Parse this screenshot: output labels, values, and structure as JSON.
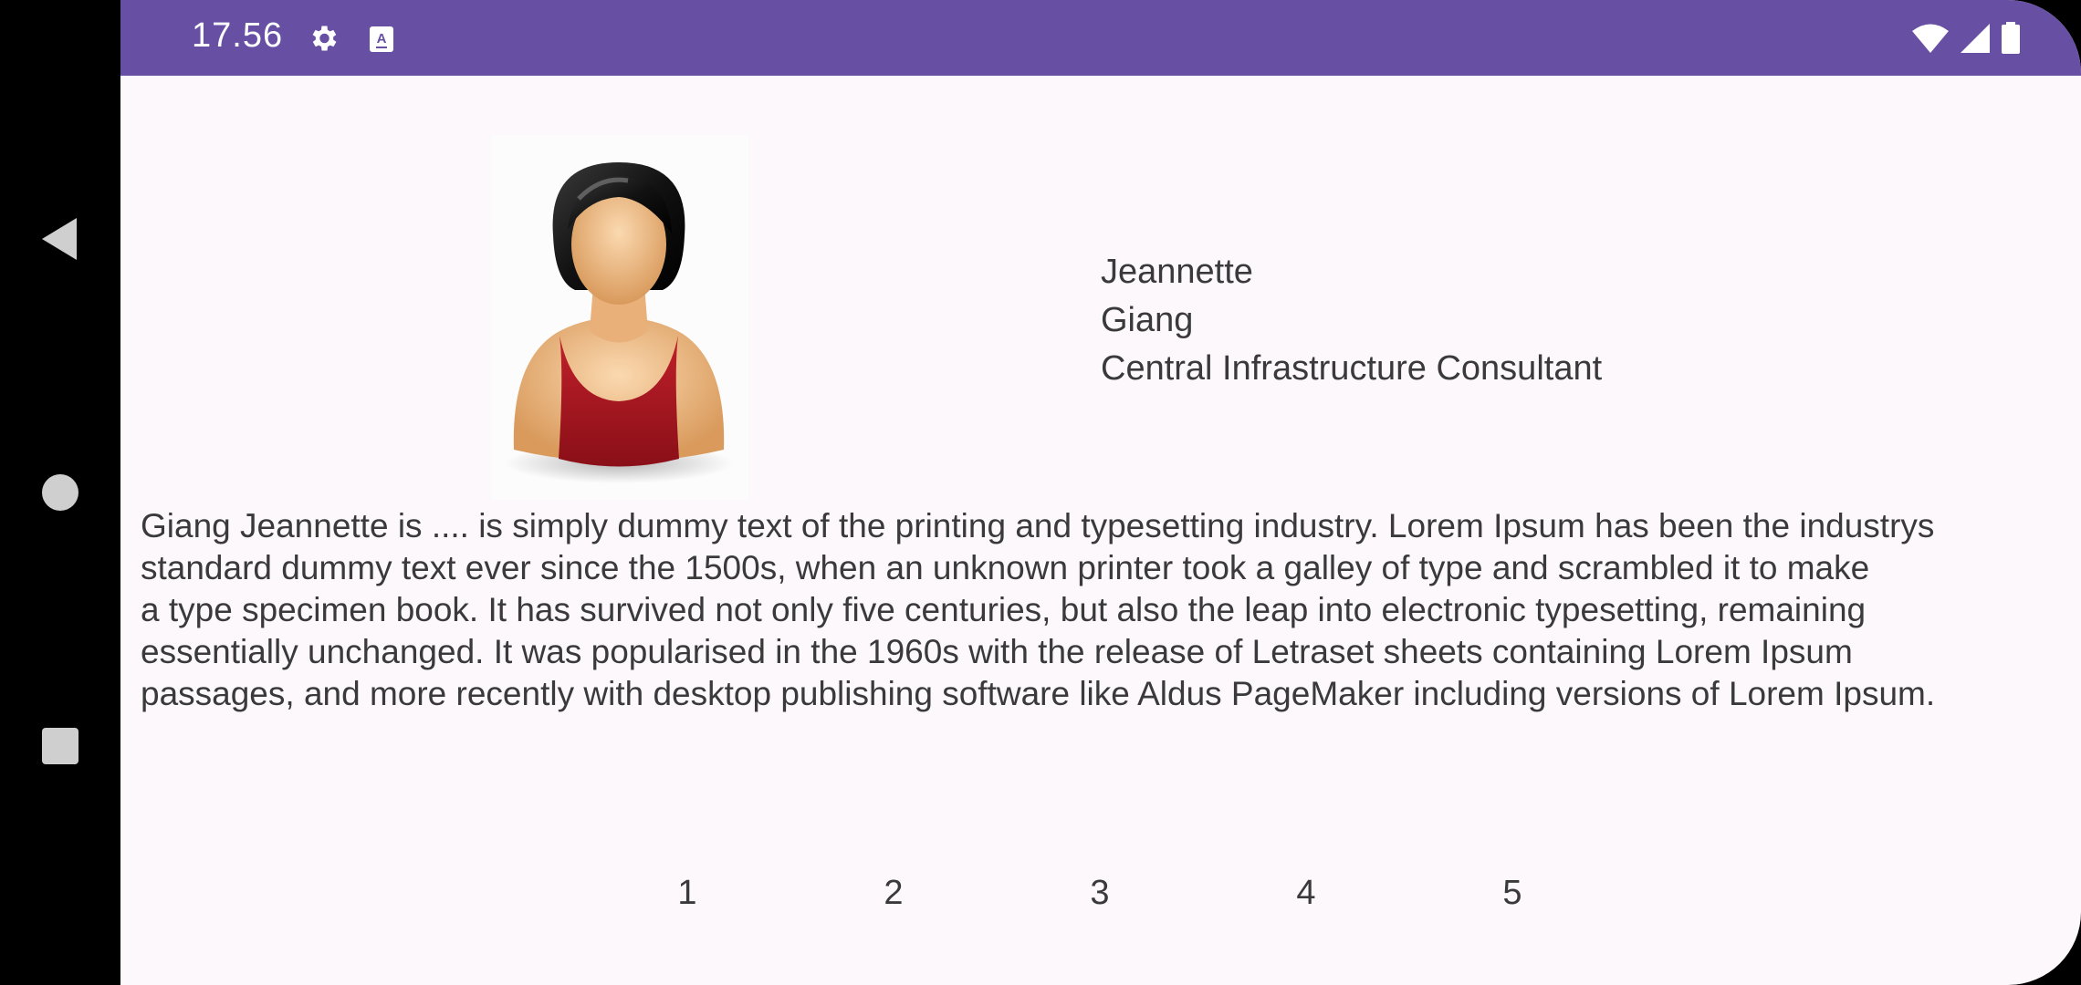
{
  "status_bar": {
    "time": "17.56",
    "icons": [
      "gear-icon",
      "a-icon",
      "wifi-icon",
      "signal-icon",
      "battery-icon"
    ]
  },
  "nav": {
    "back_icon": "back-triangle-icon",
    "home_icon": "home-circle-icon",
    "recents_icon": "recents-square-icon"
  },
  "profile": {
    "avatar_icon": "user-avatar-icon",
    "first_name": "Jeannette",
    "last_name": "Giang",
    "title": "Central Infrastructure Consultant"
  },
  "description": {
    "lines": [
      "Giang Jeannette is .... is simply dummy text of the printing and typesetting industry. Lorem Ipsum has been the industrys",
      "standard dummy text ever since the 1500s, when an unknown printer took a galley of type and scrambled it to make",
      "a type specimen book. It has survived not only five centuries, but also the leap into electronic typesetting, remaining",
      "essentially unchanged. It was popularised in the 1960s with the release of Letraset sheets containing Lorem Ipsum",
      "passages, and more recently with desktop publishing software like Aldus PageMaker including versions of Lorem Ipsum."
    ]
  },
  "pager": {
    "pages": [
      "1",
      "2",
      "3",
      "4",
      "5"
    ]
  },
  "colors": {
    "status_bar": "#6750a4",
    "background": "#fdf8fc",
    "text": "#3a3a3a"
  }
}
